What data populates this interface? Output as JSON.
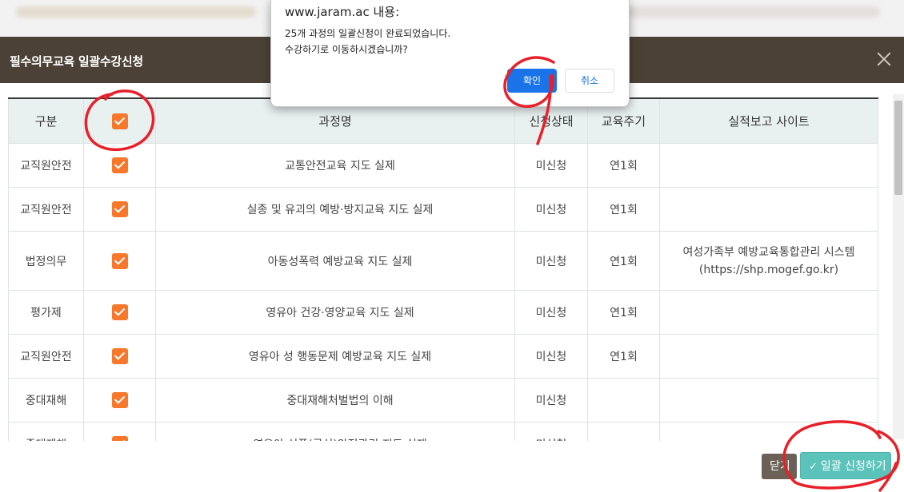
{
  "modal": {
    "title": "필수의무교육 일괄수강신청"
  },
  "table": {
    "headers": {
      "category": "구분",
      "course": "과정명",
      "status": "신청상태",
      "cycle": "교육주기",
      "site": "실적보고 사이트"
    },
    "rows": [
      {
        "category": "교직원안전",
        "course": "교통안전교육 지도 실제",
        "status": "미신청",
        "cycle": "연1회",
        "site_line1": "",
        "site_line2": "",
        "checked": true
      },
      {
        "category": "교직원안전",
        "course": "실종 및 유괴의 예방·방지교육 지도 실제",
        "status": "미신청",
        "cycle": "연1회",
        "site_line1": "",
        "site_line2": "",
        "checked": true
      },
      {
        "category": "법정의무",
        "course": "아동성폭력 예방교육 지도 실제",
        "status": "미신청",
        "cycle": "연1회",
        "site_line1": "여성가족부 예방교육통합관리 시스템",
        "site_line2": "(https://shp.mogef.go.kr)",
        "checked": true
      },
      {
        "category": "평가제",
        "course": "영유아 건강·영양교육 지도 실제",
        "status": "미신청",
        "cycle": "연1회",
        "site_line1": "",
        "site_line2": "",
        "checked": true
      },
      {
        "category": "교직원안전",
        "course": "영유아 성 행동문제 예방교육 지도 실제",
        "status": "미신청",
        "cycle": "연1회",
        "site_line1": "",
        "site_line2": "",
        "checked": true
      },
      {
        "category": "중대재해",
        "course": "중대재해처벌법의 이해",
        "status": "미신청",
        "cycle": "",
        "site_line1": "",
        "site_line2": "",
        "checked": true
      },
      {
        "category": "중대재해",
        "course": "영유아 식품(급식)안전관리 지도 실제",
        "status": "미신청",
        "cycle": "",
        "site_line1": "",
        "site_line2": "",
        "checked": true
      }
    ]
  },
  "footer": {
    "close_label": "닫기",
    "apply_label": "일괄 신청하기"
  },
  "alert": {
    "origin": "www.jaram.ac 내용:",
    "message": "25개 과정의 일괄신청이 완료되었습니다.\n수강하기로 이동하시겠습니까?",
    "ok_label": "확인",
    "cancel_label": "취소"
  },
  "colors": {
    "header_bg": "#4b4136",
    "checkbox": "#f7782b",
    "apply_button": "#5cc3bb",
    "annotation": "#e8202a"
  }
}
